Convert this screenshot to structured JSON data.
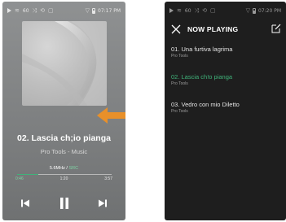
{
  "player": {
    "status": {
      "volume": "60",
      "time": "07:17 PM"
    },
    "track_title": "02. Lascia ch;io pianga",
    "track_sub": "Pro Tools - Music",
    "format": "5.6MHz",
    "format_sep": "/",
    "format_mode": "SRC",
    "time_current": "0:46",
    "time_mid": "1:20",
    "time_end": "3:57",
    "progress": 0.22,
    "colors": {
      "accent": "#3fb37a",
      "arrow": "#e8902a"
    },
    "icons": [
      "play-icon",
      "volume-icon",
      "shuffle-icon",
      "repeat-icon",
      "queue-icon",
      "wifi-icon",
      "battery-icon",
      "prev-icon",
      "pause-icon",
      "next-icon"
    ]
  },
  "now_playing": {
    "status": {
      "volume": "60",
      "time": "07:20 PM"
    },
    "title": "NOW PLAYING",
    "items": [
      {
        "title": "01. Una furtiva lagrima",
        "sub": "Pro Tools",
        "active": false
      },
      {
        "title": "02. Lascia ch!o pianga",
        "sub": "Pro Tools",
        "active": true
      },
      {
        "title": "03. Vedro con mio Diletto",
        "sub": "Pro Tools",
        "active": false
      }
    ],
    "icons": [
      "close-icon",
      "edit-icon"
    ]
  }
}
